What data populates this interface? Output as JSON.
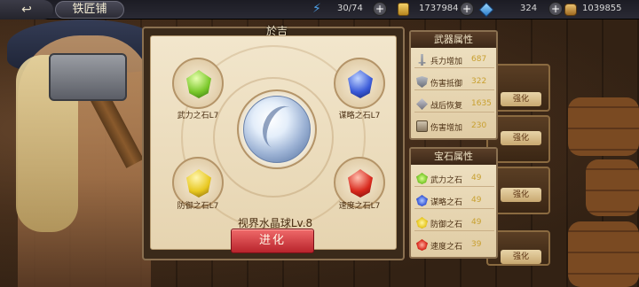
{
  "header": {
    "back_label": "↩",
    "title": "铁匠铺",
    "energy": "30/74",
    "gold": "1737984",
    "gems": "324",
    "items": "1039855",
    "plus": "+"
  },
  "dialog": {
    "title": "於吉",
    "orb_name": "视界水晶球Lv.8",
    "evolve_label": "进化",
    "slots": [
      {
        "label": "武力之石L7",
        "color": "#7ac82a"
      },
      {
        "label": "谋略之石L7",
        "color": "#3a5ad8"
      },
      {
        "label": "防御之石L7",
        "color": "#e8c820"
      },
      {
        "label": "速度之石L7",
        "color": "#d8281c"
      }
    ]
  },
  "weapon_attrs": {
    "title": "武器属性",
    "rows": [
      {
        "label": "兵力增加",
        "value": "687",
        "icon": "sword-icon"
      },
      {
        "label": "伤害抵御",
        "value": "322",
        "icon": "shield-icon"
      },
      {
        "label": "战后恢复",
        "value": "1635",
        "icon": "heal-icon"
      },
      {
        "label": "伤害增加",
        "value": "230",
        "icon": "book-icon"
      }
    ]
  },
  "gem_attrs": {
    "title": "宝石属性",
    "rows": [
      {
        "label": "武力之石",
        "value": "49",
        "color": "#7ac82a"
      },
      {
        "label": "谋略之石",
        "value": "49",
        "color": "#3a5ad8"
      },
      {
        "label": "防御之石",
        "value": "49",
        "color": "#e8c820"
      },
      {
        "label": "速度之石",
        "value": "39",
        "color": "#d8281c"
      }
    ]
  },
  "side_buttons": {
    "label": "强化"
  }
}
